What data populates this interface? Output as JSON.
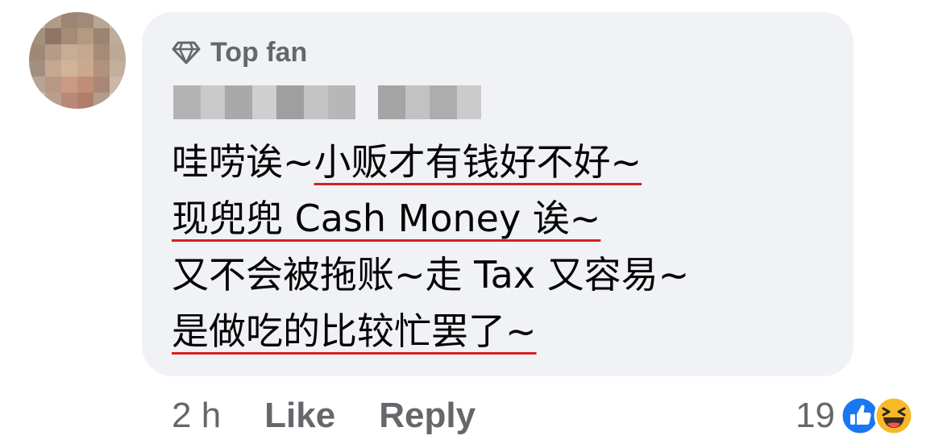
{
  "comment": {
    "badge_label": "Top fan",
    "lines": [
      {
        "plain": "哇唠诶~",
        "underlined": "小贩才有钱好不好~"
      },
      {
        "plain": "",
        "underlined": "现兜兜 Cash Money 诶~"
      },
      {
        "plain": "又不会被拖账~走 Tax 又容易~",
        "underlined": ""
      },
      {
        "plain": "",
        "underlined": "是做吃的比较忙罢了~"
      }
    ]
  },
  "footer": {
    "timestamp": "2 h",
    "like_label": "Like",
    "reply_label": "Reply",
    "reaction_count": "19"
  },
  "icons": {
    "badge": "diamond-icon",
    "reaction_1": "like-reaction-icon",
    "reaction_2": "haha-reaction-icon"
  },
  "colors": {
    "bubble": "#f0f2f5",
    "text": "#050505",
    "muted": "#65676b",
    "underline": "#d61f1f",
    "like_blue": "#1877f2",
    "haha_yellow": "#f7b928"
  }
}
